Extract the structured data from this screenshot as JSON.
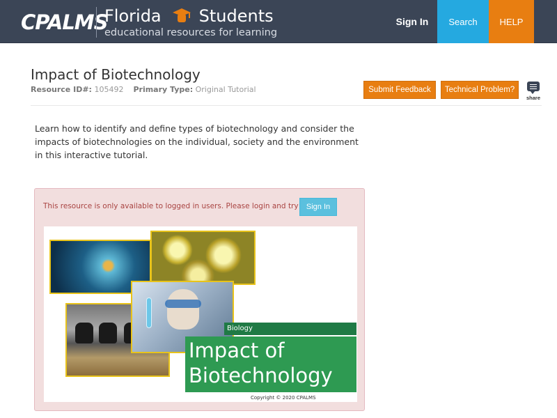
{
  "header": {
    "logo_text": "CPALMS",
    "brand_state": "Florida",
    "brand_audience": "Students",
    "brand_tagline": "educational resources for learning",
    "nav": {
      "sign_in": "Sign In",
      "search": "Search",
      "help": "HELP"
    },
    "colors": {
      "bar": "#3b4556",
      "search": "#25a9e0",
      "help": "#e87e11"
    }
  },
  "resource": {
    "title": "Impact of Biotechnology",
    "id_label": "Resource ID#:",
    "id_value": "105492",
    "type_label": "Primary Type:",
    "type_value": "Original Tutorial",
    "buttons": {
      "feedback": "Submit Feedback",
      "technical": "Technical Problem?",
      "share": "share"
    },
    "description": "Learn how to identify and define types of biotechnology and consider the impacts of biotechnologies on the individual, society and the environment in this interactive tutorial."
  },
  "alert": {
    "message": "This resource is only available to logged in users. Please login and try again.",
    "sign_in": "Sign In",
    "colors": {
      "background": "#f2dede",
      "text": "#a94442",
      "button": "#5bc0de"
    }
  },
  "tutorial_image": {
    "subject": "Biology",
    "title_line1": "Impact of",
    "title_line2": "Biotechnology",
    "copyright": "Copyright © 2020 CPALMS",
    "colors": {
      "subject_bar": "#1f7a45",
      "title_card": "#2e9a52",
      "photo_border": "#e8c31a"
    }
  }
}
